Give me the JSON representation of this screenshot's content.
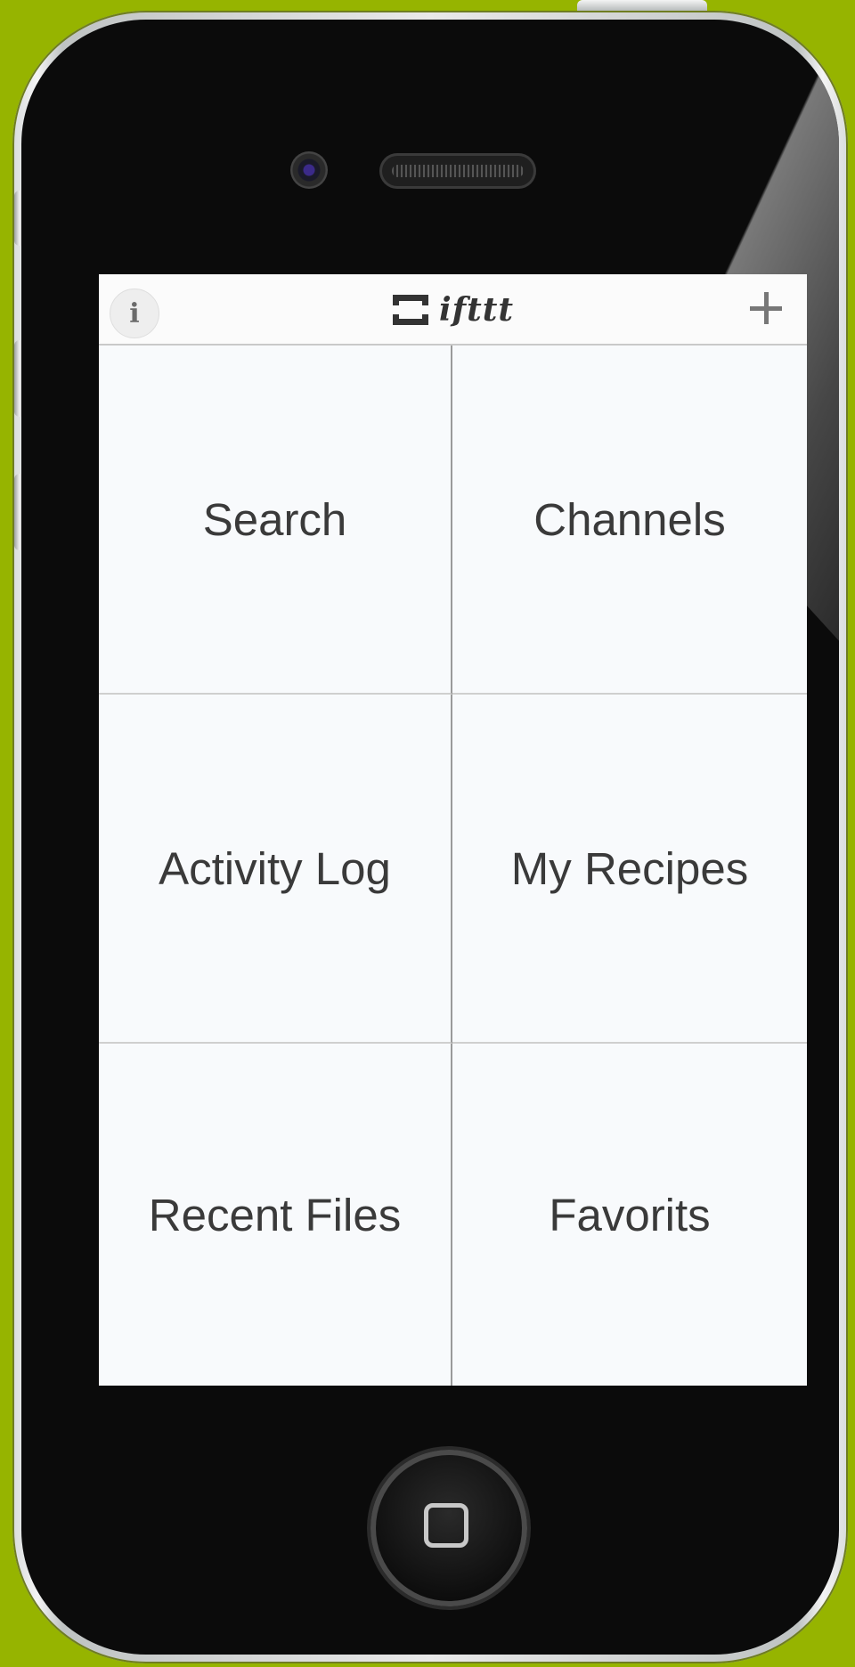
{
  "app": {
    "logo_text": "ifttt"
  },
  "navbar": {
    "info_label": "i",
    "add_icon": "plus-icon",
    "info_icon": "info-icon"
  },
  "tiles": [
    {
      "label": "Search"
    },
    {
      "label": "Channels"
    },
    {
      "label": "Activity Log"
    },
    {
      "label": "My Recipes"
    },
    {
      "label": "Recent Files"
    },
    {
      "label": "Favorits"
    }
  ],
  "colors": {
    "background": "#96b400",
    "screen": "#f8fafc",
    "tile_text": "#3a3a3a"
  }
}
